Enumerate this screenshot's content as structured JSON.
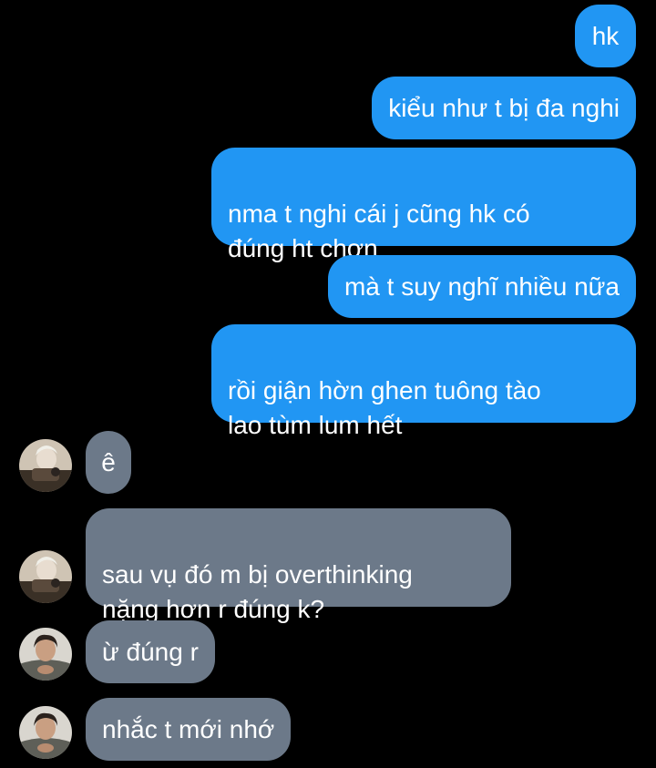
{
  "messages": [
    {
      "side": "sent",
      "text": "hk"
    },
    {
      "side": "sent",
      "text": "kiểu như t bị đa nghi"
    },
    {
      "side": "sent",
      "text": "nma t nghi cái j cũng hk có\nđúng ht chơn"
    },
    {
      "side": "sent",
      "text": "mà t suy nghĩ nhiều nữa"
    },
    {
      "side": "sent",
      "text": "rồi giận hờn ghen tuông tào\nlao tùm lum hết"
    },
    {
      "side": "received",
      "text": "ê",
      "avatar": "contact-a-avatar"
    },
    {
      "side": "received",
      "text": "sau vụ đó m bị overthinking\nnặng hơn r đúng k?",
      "avatar": "contact-a-avatar"
    },
    {
      "side": "received",
      "text": "ừ đúng r",
      "avatar": "contact-b-avatar"
    },
    {
      "side": "received",
      "text": "nhắc t mới nhớ",
      "avatar": "contact-b-avatar"
    }
  ],
  "colors": {
    "background": "#000000",
    "sent_bubble": "#2196f3",
    "received_bubble": "#6c7989",
    "text": "#ffffff"
  }
}
